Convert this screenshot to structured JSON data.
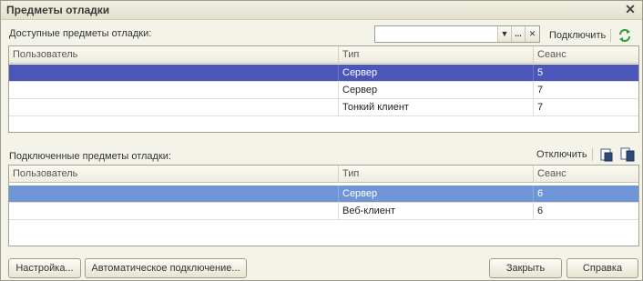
{
  "window": {
    "title": "Предметы отладки",
    "close_glyph": "✕"
  },
  "available": {
    "label": "Доступные предметы отладки:",
    "filter": {
      "value": "",
      "dropdown_glyph": "▼",
      "select_glyph": "...",
      "clear_glyph": "✕"
    },
    "connect_label": "Подключить",
    "refresh_icon": "refresh-icon",
    "columns": [
      "Пользователь",
      "Тип",
      "Сеанс"
    ],
    "rows": [
      {
        "user": "",
        "type": "Сервер",
        "session": "5",
        "selected": true
      },
      {
        "user": "",
        "type": "Сервер",
        "session": "7"
      },
      {
        "user": "",
        "type": "Тонкий клиент",
        "session": "7"
      }
    ]
  },
  "connected": {
    "label": "Подключенные предметы отладки:",
    "disconnect_label": "Отключить",
    "columns": [
      "Пользователь",
      "Тип",
      "Сеанс"
    ],
    "rows": [
      {
        "user": "",
        "type": "Сервер",
        "session": "6",
        "selected": true
      },
      {
        "user": "",
        "type": "Веб-клиент",
        "session": "6"
      }
    ]
  },
  "footer": {
    "settings": "Настройка...",
    "auto_connect": "Автоматическое подключение...",
    "close": "Закрыть",
    "help": "Справка"
  },
  "colors": {
    "selection_primary": "#4c55b8",
    "selection_secondary": "#6f95d4",
    "refresh_green": "#2f9a3a"
  }
}
